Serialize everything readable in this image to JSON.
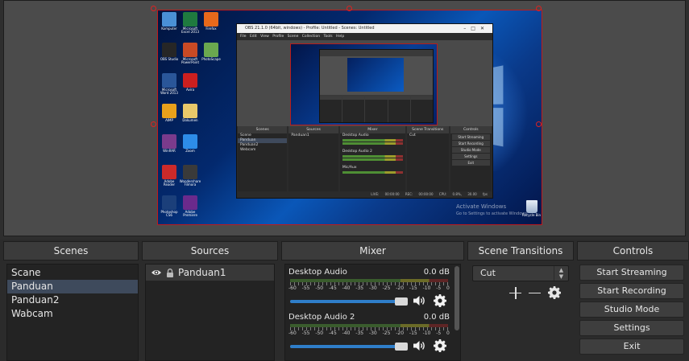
{
  "nested_obs": {
    "title": "OBS 21.1.0 (64bit, windows) - Profile: Untitled - Scenes: Untitled",
    "menu": "File  Edit  View  Profile  Scene Collection  Tools  Help",
    "docks": {
      "scenes": "Scenes",
      "sources": "Sources",
      "mixer": "Mixer",
      "transitions": "Scene Transitions",
      "controls": "Controls"
    },
    "scenes": [
      "Scene",
      "Panduan",
      "Panduan2",
      "Webcam"
    ],
    "source": "Panduan1",
    "channels": [
      "Desktop Audio",
      "Desktop Audio 2",
      "Mic/Aux"
    ],
    "transition": "Cut",
    "buttons": [
      "Start Streaming",
      "Start Recording",
      "Studio Mode",
      "Settings",
      "Exit"
    ],
    "status": "LIVE: 00:00:00   REC: 00:00:00   CPU: 0.8%, 30.00 fps"
  },
  "desktop": {
    "icons": [
      {
        "label": "Komputer",
        "color": "#4a90d6"
      },
      {
        "label": "Microsoft Excel 2013",
        "color": "#1f7a3f"
      },
      {
        "label": "Firefox",
        "color": "#e8691b"
      },
      {
        "label": "OBS Studio",
        "color": "#262626"
      },
      {
        "label": "Microsoft PowerPoint",
        "color": "#c94a25"
      },
      {
        "label": "PhotoScape",
        "color": "#6aa84f"
      },
      {
        "label": "Microsoft Word 2013",
        "color": "#2a5699"
      },
      {
        "label": "Avira",
        "color": "#cc1f1f"
      },
      {
        "label": "AIMP",
        "color": "#e8a01b"
      },
      {
        "label": "Dokumen",
        "color": "#e8c86a"
      },
      {
        "label": "WinRAR",
        "color": "#7a3b8c"
      },
      {
        "label": "Zoom",
        "color": "#2d8ce8"
      },
      {
        "label": "Adobe Reader",
        "color": "#cc2a2a"
      },
      {
        "label": "Wondershare Filmora",
        "color": "#3a3a3a"
      },
      {
        "label": "Photoshop CS6",
        "color": "#1b3f7a"
      },
      {
        "label": "Adobe Premiere",
        "color": "#6a2a8c"
      }
    ],
    "activate_line1": "Activate Windows",
    "activate_line2": "Go to Settings to activate Windows.",
    "recycle_label": "Recycle Bin"
  },
  "scenes": {
    "header": "Scenes",
    "items": [
      {
        "label": "Scane",
        "selected": false
      },
      {
        "label": "Panduan",
        "selected": true
      },
      {
        "label": "Panduan2",
        "selected": false
      },
      {
        "label": "Wabcam",
        "selected": false
      }
    ]
  },
  "sources": {
    "header": "Sources",
    "items": [
      {
        "label": "Panduan1",
        "visible": true,
        "locked": true
      }
    ]
  },
  "mixer": {
    "header": "Mixer",
    "scale": [
      "-60",
      "-55",
      "-50",
      "-45",
      "-40",
      "-35",
      "-30",
      "-25",
      "-20",
      "-15",
      "-10",
      "-5",
      "0"
    ],
    "channels": [
      {
        "name": "Desktop Audio",
        "db": "0.0 dB",
        "volume": 1.0
      },
      {
        "name": "Desktop Audio 2",
        "db": "0.0 dB",
        "volume": 1.0
      }
    ]
  },
  "transitions": {
    "header": "Scene Transitions",
    "selected": "Cut"
  },
  "controls": {
    "header": "Controls",
    "buttons": [
      "Start Streaming",
      "Start Recording",
      "Studio Mode",
      "Settings",
      "Exit"
    ]
  },
  "colors": {
    "accent": "#2f7ec9",
    "selection": "#3e4a5c",
    "preview_border": "#c21a1a",
    "panel": "#2b2b2b",
    "header": "#3b3b3b"
  }
}
